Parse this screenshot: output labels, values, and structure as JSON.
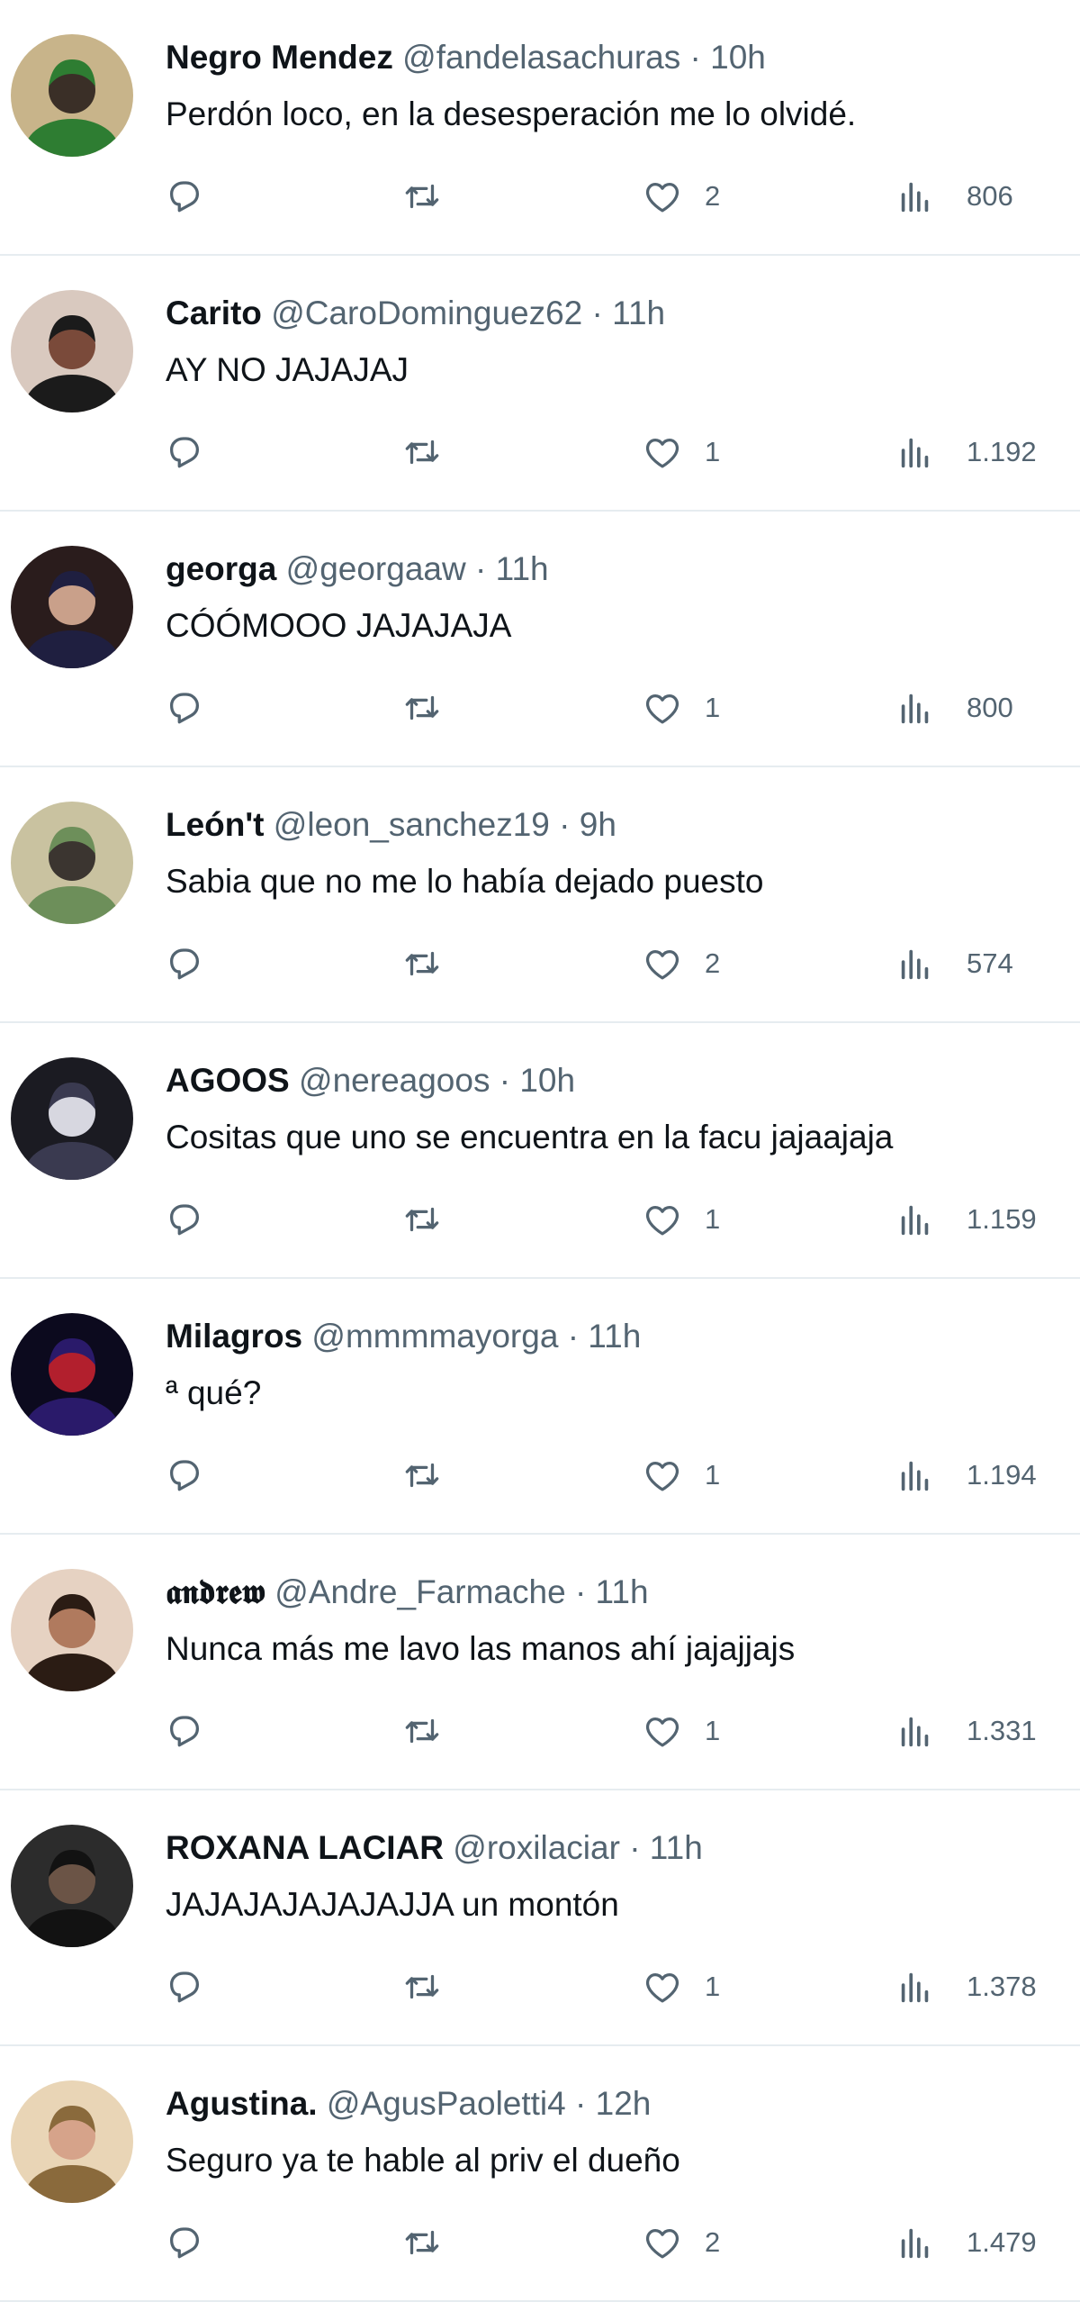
{
  "tweets": [
    {
      "name": "Negro Mendez",
      "handle": "@fandelasachuras",
      "sep": "·",
      "time": "10h",
      "text": "Perdón loco, en la desesperación me lo olvidé.",
      "likes": "2",
      "views": "806",
      "avatar_colors": {
        "bg": "#c8b48a",
        "skin": "#3a2f27",
        "hat": "#2e7d32"
      }
    },
    {
      "name": "Carito",
      "handle": "@CaroDominguez62",
      "sep": "·",
      "time": "11h",
      "text": "AY NO JAJAJAJ",
      "likes": "1",
      "views": "1.192",
      "avatar_colors": {
        "bg": "#d9c9bf",
        "skin": "#7a4a3a",
        "hat": "#1b1b1b"
      }
    },
    {
      "name": "georga",
      "handle": "@georgaaw",
      "sep": "·",
      "time": "11h",
      "text": "CÓÓMOOO JAJAJAJA",
      "likes": "1",
      "views": "800",
      "avatar_colors": {
        "bg": "#2a1c1c",
        "skin": "#c9a08a",
        "hat": "#1f1f40"
      }
    },
    {
      "name": "León't",
      "handle": "@leon_sanchez19",
      "sep": "·",
      "time": "9h",
      "text": "Sabia que no me lo había dejado puesto",
      "likes": "2",
      "views": "574",
      "avatar_colors": {
        "bg": "#c9c2a0",
        "skin": "#3b3530",
        "hat": "#6d8f5a"
      }
    },
    {
      "name": "AGOOS",
      "handle": "@nereagoos",
      "sep": "·",
      "time": "10h",
      "text": "Cositas que uno se encuentra en la facu jajaajaja",
      "likes": "1",
      "views": "1.159",
      "avatar_colors": {
        "bg": "#1b1b22",
        "skin": "#d7d7e0",
        "hat": "#3a3a50"
      }
    },
    {
      "name": "Milagros",
      "handle": "@mmmmayorga",
      "sep": "·",
      "time": "11h",
      "text": "ª qué?",
      "likes": "1",
      "views": "1.194",
      "avatar_colors": {
        "bg": "#0c0a1e",
        "skin": "#b21f2d",
        "hat": "#2a1a6a"
      }
    },
    {
      "name": "𝖆𝖓𝖉𝖗𝖊𝖜",
      "handle": "@Andre_Farmache",
      "sep": "·",
      "time": "11h",
      "text": "Nunca más me lavo las manos ahí jajajjajs",
      "likes": "1",
      "views": "1.331",
      "avatar_colors": {
        "bg": "#e6d2c2",
        "skin": "#b07a5e",
        "hat": "#2b1c14"
      }
    },
    {
      "name": "ROXANA LACIAR",
      "handle": "@roxilaciar",
      "sep": "·",
      "time": "11h",
      "text": "JAJAJAJAJAJAJJA un montón",
      "likes": "1",
      "views": "1.378",
      "avatar_colors": {
        "bg": "#2c2c2c",
        "skin": "#6b5446",
        "hat": "#121212"
      }
    },
    {
      "name": "Agustina.",
      "handle": "@AgusPaoletti4",
      "sep": "·",
      "time": "12h",
      "text": "Seguro ya te hable al priv el dueño",
      "likes": "2",
      "views": "1.479",
      "avatar_colors": {
        "bg": "#e9d5b6",
        "skin": "#d6a38a",
        "hat": "#8a6a3c"
      }
    }
  ],
  "icons": {
    "reply": "reply-icon",
    "retweet": "retweet-icon",
    "like": "like-icon",
    "views": "views-icon"
  },
  "colors": {
    "text": "#0f1419",
    "muted": "#536471",
    "divider": "#e6ecf0"
  }
}
